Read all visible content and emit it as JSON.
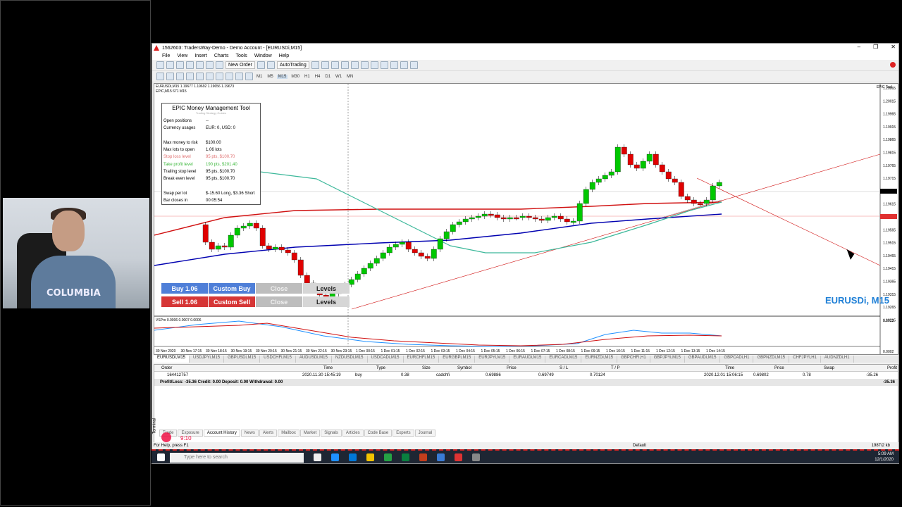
{
  "window": {
    "title": "1562603: TradersWay-Demo - Demo Account - [EURUSDi,M15]",
    "menu": [
      "File",
      "View",
      "Insert",
      "Charts",
      "Tools",
      "Window",
      "Help"
    ],
    "toolbar": {
      "new_order": "New Order",
      "autotrading": "AutoTrading",
      "timeframes": [
        "M1",
        "M5",
        "M15",
        "M30",
        "H1",
        "H4",
        "D1",
        "W1",
        "MN"
      ]
    }
  },
  "chart": {
    "price_info": "EURUSDi,M15  1.19677 1.19692 1.19656 1.19673",
    "indicator_info": "EPIC,M15 671 M15",
    "epic_tool_tag": "EPIC Tool",
    "symbol_watermark": "EURUSDi, M15",
    "osc_label": "VSPro 0.0006 0.0007 0.0006",
    "price_axis": [
      "1.20065",
      "1.20015",
      "1.19965",
      "1.19915",
      "1.19865",
      "1.19815",
      "1.19765",
      "1.19715",
      "1.19673",
      "1.19615",
      "1.19606",
      "1.19565",
      "1.19515",
      "1.19465",
      "1.19415",
      "1.19365",
      "1.19315",
      "1.19265",
      "1.19215"
    ],
    "osc_axis": [
      "0.0013",
      "0.0002"
    ],
    "time_axis": [
      "30 Nov 2020",
      "30 Nov 17:15",
      "30 Nov 18:15",
      "30 Nov 19:15",
      "30 Nov 20:15",
      "30 Nov 21:15",
      "30 Nov 22:15",
      "30 Nov 23:15",
      "1 Dec 00:15",
      "1 Dec 01:15",
      "1 Dec 02:15",
      "1 Dec 03:15",
      "1 Dec 04:15",
      "1 Dec 05:15",
      "1 Dec 06:15",
      "1 Dec 07:15",
      "1 Dec 08:15",
      "1 Dec 09:15",
      "1 Dec 10:15",
      "1 Dec 11:15",
      "1 Dec 12:15",
      "1 Dec 13:15",
      "1 Dec 14:15"
    ],
    "colors": {
      "bull": "#00c800",
      "bear": "#e00000",
      "ma_red": "#d01010",
      "ma_blue": "#0000b0",
      "ma_teal": "#3cb89a",
      "osc_blue": "#1e90ff",
      "osc_red": "#d01010"
    }
  },
  "mm_panel": {
    "title": "EPIC Money Management Tool",
    "subtitle": "Trading Strategy Guides",
    "rows": [
      {
        "k": "Open positions",
        "v": "--",
        "c": "#000"
      },
      {
        "k": "Currency usages",
        "v": "EUR: 0, USD: 0",
        "c": "#000"
      },
      {
        "k": "Max money to risk",
        "v": "$100.00",
        "c": "#000"
      },
      {
        "k": "Max lots to open",
        "v": "1.06 lots",
        "c": "#000"
      },
      {
        "k": "Stop loss level",
        "v": "95 pts, $100.70",
        "c": "#e07070"
      },
      {
        "k": "Take profit level",
        "v": "190 pts, $201.40",
        "c": "#3cb83c"
      },
      {
        "k": "Trailing stop level",
        "v": "95 pts, $100.70",
        "c": "#000"
      },
      {
        "k": "Break even level",
        "v": "95 pts, $100.70",
        "c": "#000"
      },
      {
        "k": "Swap per lot",
        "v": "$-15.60 Long, $3.36 Short",
        "c": "#000"
      },
      {
        "k": "Bar closes in",
        "v": "00:05:54",
        "c": "#000"
      }
    ]
  },
  "trade_buttons": {
    "buy": "Buy 1.06",
    "custom_buy": "Custom Buy",
    "close1": "Close",
    "levels1": "Levels",
    "sell": "Sell 1.06",
    "custom_sell": "Custom Sell",
    "close2": "Close",
    "levels2": "Levels"
  },
  "chart_tabs": [
    "EURUSDi,M15",
    "USDJPYi,M15",
    "GBPUSDi,M15",
    "USDCHFi,M15",
    "AUDUSDi,M15",
    "NZDUSDi,M15",
    "USDCADi,M15",
    "EURCHFi,M15",
    "EURGBPi,M15",
    "EURJPYi,M15",
    "EURAUDi,M15",
    "EURCADi,M15",
    "EURNZDi,M15",
    "GBPCHFi,H1",
    "GBPJPYi,M15",
    "GBPAUDi,M15",
    "GBPCADi,H1",
    "GBPNZDi,M15",
    "CHFJPYi,H1",
    "AUDNZDi,H1"
  ],
  "terminal": {
    "headers": [
      "Order",
      "Time",
      "Type",
      "Size",
      "Symbol",
      "Price",
      "S / L",
      "T / P",
      "Time",
      "Price",
      "Swap",
      "Profit"
    ],
    "row": [
      "164412757",
      "2020.11.30 15:45:19",
      "buy",
      "0.38",
      "cadchfi",
      "0.69886",
      "0.69749",
      "0.70124",
      "2020.12.01 15:06:15",
      "0.69802",
      "0.78",
      "-35.26"
    ],
    "summary": "Profit/Loss: -35.36  Credit: 0.00  Deposit: 0.00  Withdrawal: 0.00",
    "summary_value": "-35.36",
    "tabs": [
      "Trade",
      "Exposure",
      "Account History",
      "News",
      "Alerts",
      "Mailbox",
      "Market",
      "Signals",
      "Articles",
      "Code Base",
      "Experts",
      "Journal"
    ],
    "side_label": "Terminal"
  },
  "status": {
    "left": "For Help, press F1",
    "profile": "Default",
    "traffic": "1987/2 kb"
  },
  "taskbar": {
    "search": "Type here to search",
    "time": "5:09 AM",
    "date": "12/1/2020"
  },
  "recorder": {
    "time": "9:10"
  }
}
